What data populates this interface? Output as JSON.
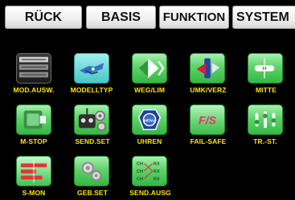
{
  "toolbar": {
    "back_label": "RÜCK",
    "basis_label": "BASIS",
    "funktion_label": "FUNKTION",
    "system_label": "SYSTEM"
  },
  "tiles": [
    {
      "label": "MOD.AUSW.",
      "icon": "model-select-icon"
    },
    {
      "label": "MODELLTYP",
      "icon": "model-type-icon"
    },
    {
      "label": "WEG/LIM",
      "icon": "travel-limit-icon"
    },
    {
      "label": "UMK/VERZ",
      "icon": "reverse-delay-icon"
    },
    {
      "label": "MITTE",
      "icon": "center-icon"
    },
    {
      "label": "M-STOP",
      "icon": "motor-stop-icon"
    },
    {
      "label": "SEND.SET",
      "icon": "transmitter-settings-icon"
    },
    {
      "label": "UHREN",
      "icon": "clock-icon"
    },
    {
      "label": "FAIL-SAFE",
      "icon": "fail-safe-icon"
    },
    {
      "label": "TR.-ST.",
      "icon": "trim-steps-icon"
    },
    {
      "label": "S-MON",
      "icon": "servo-monitor-icon"
    },
    {
      "label": "GEB.SET",
      "icon": "sensor-settings-icon"
    },
    {
      "label": "SEND.AUSG",
      "icon": "transmitter-output-icon"
    }
  ],
  "icon_text": {
    "uhren": "MENU",
    "failsafe": "F/S",
    "send_ausg": [
      "CH",
      "RX",
      "CH",
      "RX",
      "CH",
      "RX"
    ]
  },
  "colors": {
    "background": "#000000",
    "label": "#ffe600",
    "tile_green": "#5fd26b",
    "button_face": "#f1f1f1"
  }
}
